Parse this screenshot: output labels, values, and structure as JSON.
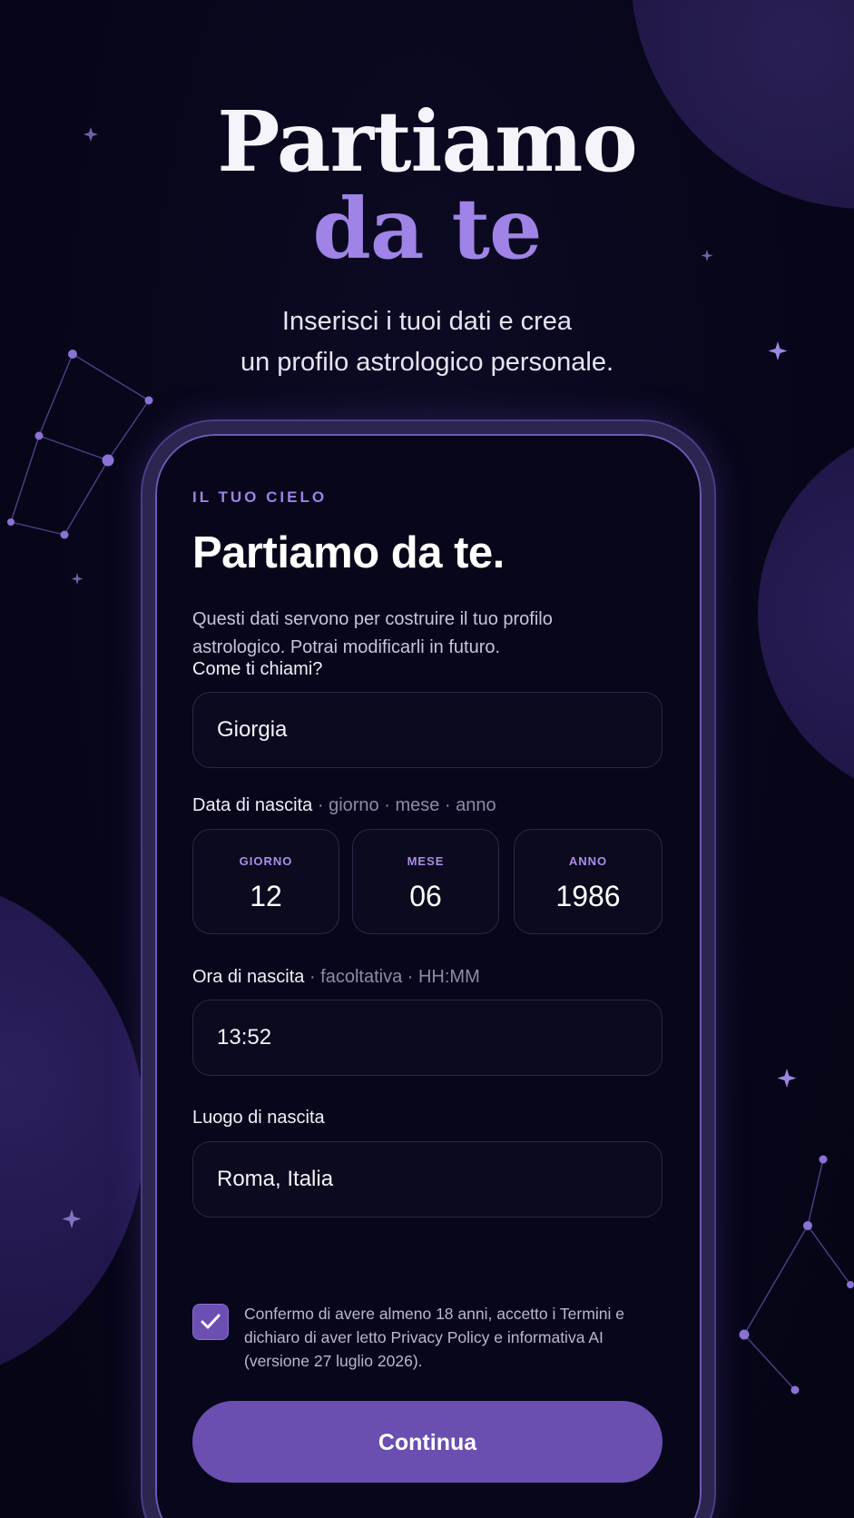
{
  "hero": {
    "title_line1": "Partiamo",
    "title_line2": "da te",
    "subtitle_line1": "Inserisci i tuoi dati e crea",
    "subtitle_line2": "un profilo astrologico personale."
  },
  "form": {
    "eyebrow": "IL TUO CIELO",
    "title": "Partiamo da te.",
    "description_line1": "Questi dati servono per costruire il tuo profilo",
    "description_line2": "astrologico. Potrai modificarli in futuro.",
    "name": {
      "label": "Come ti chiami?",
      "value": "Giorgia"
    },
    "birth_date": {
      "label": "Data di nascita",
      "hint": " · giorno · mese · anno",
      "day_caption": "GIORNO",
      "day_value": "12",
      "month_caption": "MESE",
      "month_value": "06",
      "year_caption": "ANNO",
      "year_value": "1986"
    },
    "birth_time": {
      "label": "Ora di nascita",
      "hint": " · facoltativa · HH:MM",
      "value": "13:52"
    },
    "birth_place": {
      "label": "Luogo di nascita",
      "value": "Roma, Italia"
    },
    "consent": {
      "checked": true,
      "line1": "Confermo di avere almeno 18 anni, accetto i Termini e",
      "line2": "dichiaro di aver letto Privacy Policy e informativa AI",
      "line3": "(versione 27 luglio 2026)."
    },
    "continue_label": "Continua"
  },
  "colors": {
    "background": "#07061a",
    "accent": "#9f83e6",
    "button": "#6a4fb0",
    "planet": "#1e1546"
  },
  "icons": [
    "sparkle-icon",
    "constellation-icon",
    "check-icon"
  ]
}
